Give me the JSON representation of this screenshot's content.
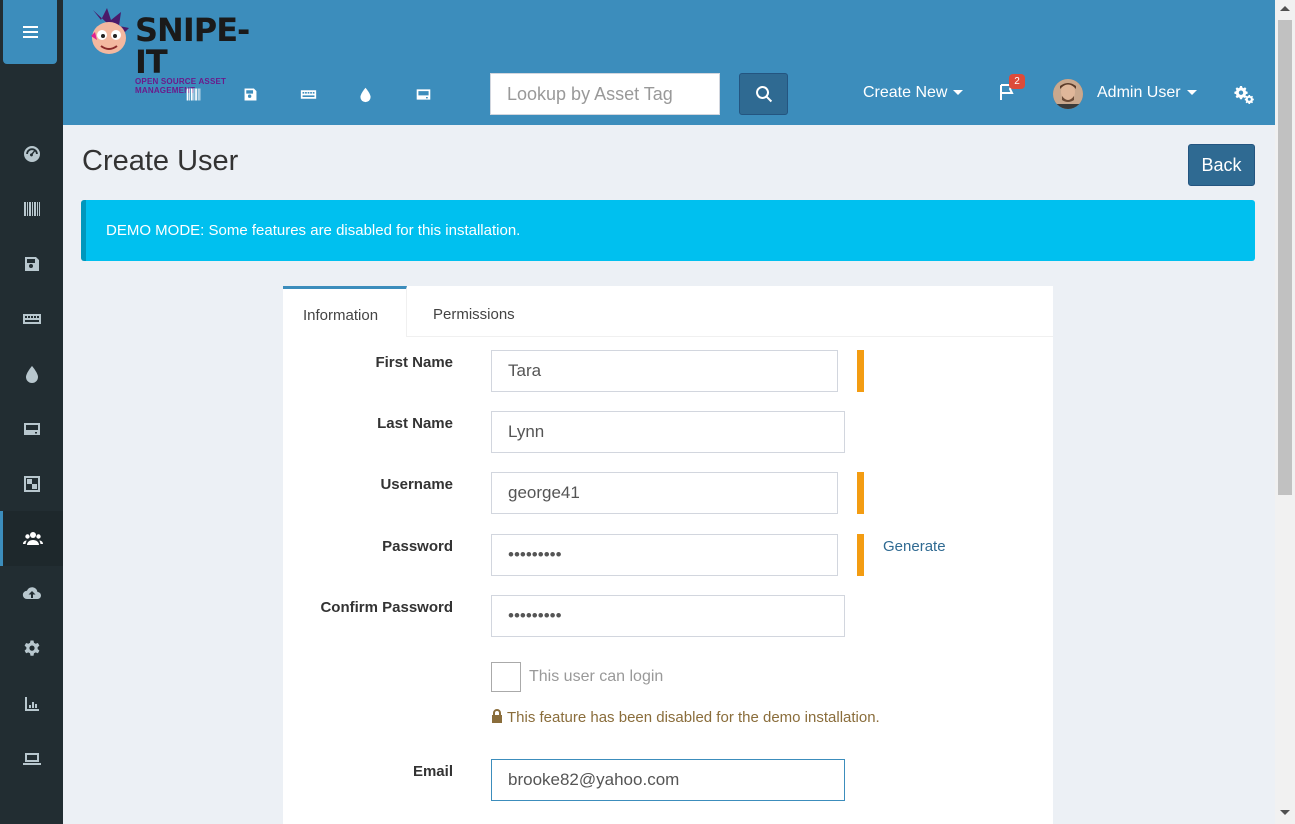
{
  "app": {
    "logo_title": "SNIPE-IT",
    "logo_subtitle": "OPEN SOURCE ASSET MANAGEMENT"
  },
  "header": {
    "search_placeholder": "Lookup by Asset Tag",
    "create_new_label": "Create New",
    "notifications_count": "2",
    "user_name": "Admin User"
  },
  "page": {
    "title": "Create User",
    "back_label": "Back",
    "alert_text": "DEMO MODE: Some features are disabled for this installation."
  },
  "tabs": [
    {
      "label": "Information",
      "active": true
    },
    {
      "label": "Permissions",
      "active": false
    }
  ],
  "form": {
    "first_name": {
      "label": "First Name",
      "value": "Tara"
    },
    "last_name": {
      "label": "Last Name",
      "value": "Lynn"
    },
    "username": {
      "label": "Username",
      "value": "george41"
    },
    "password": {
      "label": "Password",
      "value": "•••••••••",
      "generate_label": "Generate"
    },
    "confirm_password": {
      "label": "Confirm Password",
      "value": "•••••••••"
    },
    "can_login": {
      "label": "This user can login",
      "checked": false
    },
    "demo_note": "This feature has been disabled for the demo installation.",
    "email": {
      "label": "Email",
      "value": "brooke82@yahoo.com"
    }
  },
  "colors": {
    "header": "#3c8dbc",
    "sidebar": "#222d32",
    "alert": "#00c0ef",
    "required": "#f39c12",
    "primary_button": "#2f6a92"
  },
  "sidebar_icons": [
    "dashboard-icon",
    "barcode-icon",
    "license-icon",
    "keyboard-icon",
    "consumable-icon",
    "component-icon",
    "kits-icon",
    "users-icon",
    "import-icon",
    "settings-icon",
    "reports-icon",
    "requestable-icon"
  ]
}
